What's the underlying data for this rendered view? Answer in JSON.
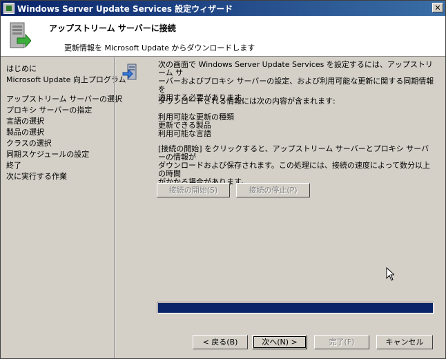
{
  "window": {
    "title": "Windows Server Update Services 設定ウィザード",
    "close_label": "✕"
  },
  "header": {
    "title": "アップストリーム サーバーに接続",
    "subtitle": "更新情報を Microsoft Update からダウンロードします"
  },
  "sidebar": {
    "steps": [
      "はじめに",
      "Microsoft Update 向上プログラム",
      "アップストリーム サーバーの選択",
      "プロキシ サーバーの指定",
      "言語の選択",
      "製品の選択",
      "クラスの選択",
      "同期スケジュールの設定",
      "終了",
      "次に実行する作業"
    ]
  },
  "content": {
    "intro_lines": [
      "次の画面で Windows Server Update Services を設定するには、アップストリーム サ",
      "ーバーおよびプロキシ サーバーの設定、および利用可能な更新に関する同期情報を",
      "適用する必要があります。"
    ],
    "download_intro": "ダウンロードされる情報には次の内容が含まれます:",
    "download_items": [
      "利用可能な更新の種類",
      "更新できる製品",
      "利用可能な言語"
    ],
    "note_lines": [
      "[接続の開始] をクリックすると、アップストリーム サーバーとプロキシ サーバーの情報が",
      "ダウンロードおよび保存されます。この処理には、接続の速度によって数分以上の時間",
      "がかかる場合があります。"
    ],
    "start_button": "接続の開始(S)",
    "stop_button": "接続の停止(P)",
    "progress_fraction": 1.0
  },
  "footer": {
    "back": "< 戻る(B)",
    "next": "次へ(N) >",
    "finish": "完了(F)",
    "cancel": "キャンセル"
  }
}
